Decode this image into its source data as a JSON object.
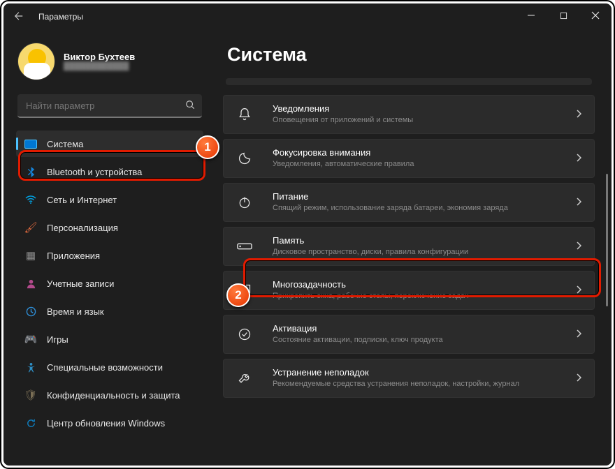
{
  "window": {
    "title": "Параметры"
  },
  "profile": {
    "name": "Виктор Бухтеев",
    "email": "████████████"
  },
  "search": {
    "placeholder": "Найти параметр"
  },
  "sidebar": {
    "items": [
      {
        "label": "Система",
        "icon": "ic-system",
        "active": true
      },
      {
        "label": "Bluetooth и устройства",
        "icon": "ic-bluetooth"
      },
      {
        "label": "Сеть и Интернет",
        "icon": "ic-network"
      },
      {
        "label": "Персонализация",
        "icon": "ic-personalization"
      },
      {
        "label": "Приложения",
        "icon": "ic-apps"
      },
      {
        "label": "Учетные записи",
        "icon": "ic-accounts"
      },
      {
        "label": "Время и язык",
        "icon": "ic-time"
      },
      {
        "label": "Игры",
        "icon": "ic-gaming"
      },
      {
        "label": "Специальные возможности",
        "icon": "ic-accessibility"
      },
      {
        "label": "Конфиденциальность и защита",
        "icon": "ic-privacy"
      },
      {
        "label": "Центр обновления Windows",
        "icon": "ic-update"
      }
    ]
  },
  "main": {
    "title": "Система",
    "cards": [
      {
        "title": "Уведомления",
        "desc": "Оповещения от приложений и системы",
        "icon": "bell"
      },
      {
        "title": "Фокусировка внимания",
        "desc": "Уведомления, автоматические правила",
        "icon": "moon"
      },
      {
        "title": "Питание",
        "desc": "Спящий режим, использование заряда батареи, экономия заряда",
        "icon": "power"
      },
      {
        "title": "Память",
        "desc": "Дисковое пространство, диски, правила конфигурации",
        "icon": "storage"
      },
      {
        "title": "Многозадачность",
        "desc": "Прикрепить окна, рабочие столы, переключение задач",
        "icon": "multi"
      },
      {
        "title": "Активация",
        "desc": "Состояние активации, подписки, ключ продукта",
        "icon": "check"
      },
      {
        "title": "Устранение неполадок",
        "desc": "Рекомендуемые средства устранения неполадок, настройки, журнал",
        "icon": "wrench"
      }
    ]
  },
  "annotations": {
    "step1": "1",
    "step2": "2"
  }
}
